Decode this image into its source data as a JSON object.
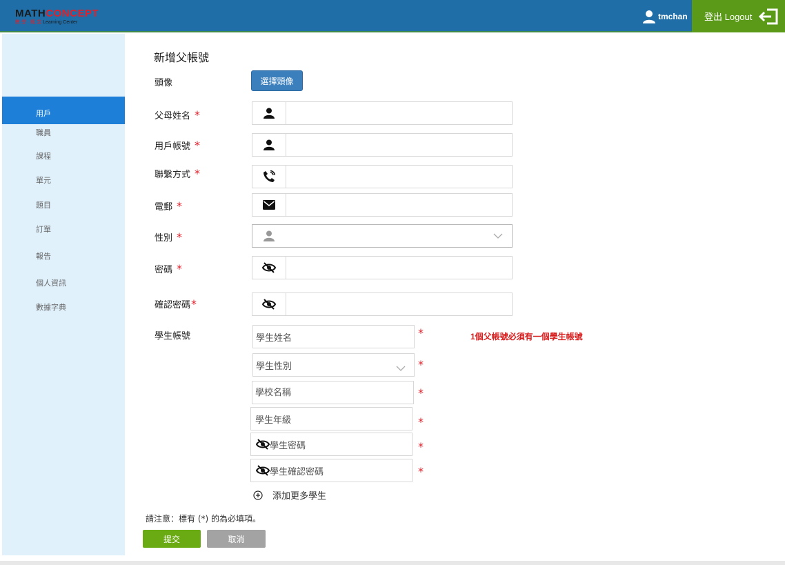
{
  "header": {
    "logo": {
      "math": "MATH",
      "concept": "CONCEPT",
      "sub_cn": "數 學 · 概 念",
      "sub_en": "Learning Center"
    },
    "username": "tmchan",
    "logout_label": "登出 Logout",
    "colors": {
      "bar": "#1f6ea8",
      "logout": "#5a9a18"
    }
  },
  "sidebar": {
    "items": [
      {
        "label": "用戶",
        "active": true
      },
      {
        "label": "職員"
      },
      {
        "label": "課程"
      },
      {
        "label": "單元"
      },
      {
        "label": "題目"
      },
      {
        "label": "訂單"
      },
      {
        "label": "報告"
      },
      {
        "label": "個人資訊"
      },
      {
        "label": "數據字典"
      }
    ]
  },
  "form": {
    "title": "新增父帳號",
    "avatar_label": "頭像",
    "avatar_button": "選擇頭像",
    "required_mark": "*",
    "fields": {
      "parent_name": {
        "label": "父母姓名",
        "icon": "user-icon",
        "value": ""
      },
      "username": {
        "label": "用戶帳號",
        "icon": "user-icon",
        "value": ""
      },
      "contact": {
        "label": "聯繫方式",
        "icon": "phone-icon",
        "value": ""
      },
      "email": {
        "label": "電郵",
        "icon": "mail-icon",
        "value": ""
      },
      "gender": {
        "label": "性別",
        "icon": "user-icon",
        "value": ""
      },
      "password": {
        "label": "密碼",
        "icon": "eye-slash-icon",
        "value": ""
      },
      "confirm_password": {
        "label": "確認密碼",
        "icon": "eye-slash-icon",
        "value": ""
      }
    },
    "student": {
      "label": "學生帳號",
      "warning": "1個父帳號必須有一個學生帳號",
      "name_placeholder": "學生姓名",
      "gender_placeholder": "學生性別",
      "school_placeholder": "學校名稱",
      "grade_placeholder": "學生年級",
      "password_placeholder": "學生密碼",
      "confirm_password_placeholder": "學生確認密碼",
      "add_more": "添加更多學生"
    },
    "note": "請注意：標有 (*) 的為必填項。",
    "submit": "提交",
    "cancel": "取消"
  }
}
